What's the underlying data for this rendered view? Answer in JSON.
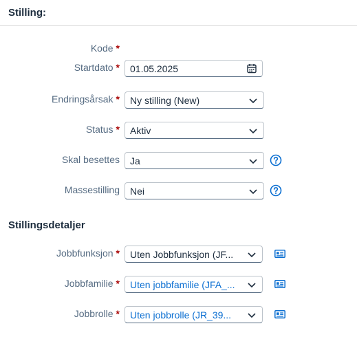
{
  "section": {
    "title": "Stilling:"
  },
  "fields": {
    "kode": {
      "label": "Kode",
      "required": "*"
    },
    "startdato": {
      "label": "Startdato",
      "required": "*",
      "value": "01.05.2025"
    },
    "endringsarsak": {
      "label": "Endringsårsak",
      "required": "*",
      "value": "Ny stilling (New)"
    },
    "status": {
      "label": "Status",
      "required": "*",
      "value": "Aktiv"
    },
    "skal_besettes": {
      "label": "Skal besettes",
      "value": "Ja"
    },
    "massestilling": {
      "label": "Massestilling",
      "value": "Nei"
    }
  },
  "details": {
    "title": "Stillingsdetaljer",
    "jobbfunksjon": {
      "label": "Jobbfunksjon",
      "required": "*",
      "value": "Uten Jobbfunksjon (JF..."
    },
    "jobbfamilie": {
      "label": "Jobbfamilie",
      "required": "*",
      "value": "Uten jobbfamilie (JFA_..."
    },
    "jobbrolle": {
      "label": "Jobbrolle",
      "required": "*",
      "value": "Uten jobbrolle (JR_39..."
    }
  },
  "colors": {
    "accent": "#0a6ed1",
    "required": "#aa0808",
    "label": "#556b82",
    "text": "#1d2d3e"
  },
  "icons": {
    "date": "calendar-icon",
    "dropdown": "chevron-down-icon",
    "help": "help-circle-icon",
    "details": "contact-card-icon"
  }
}
